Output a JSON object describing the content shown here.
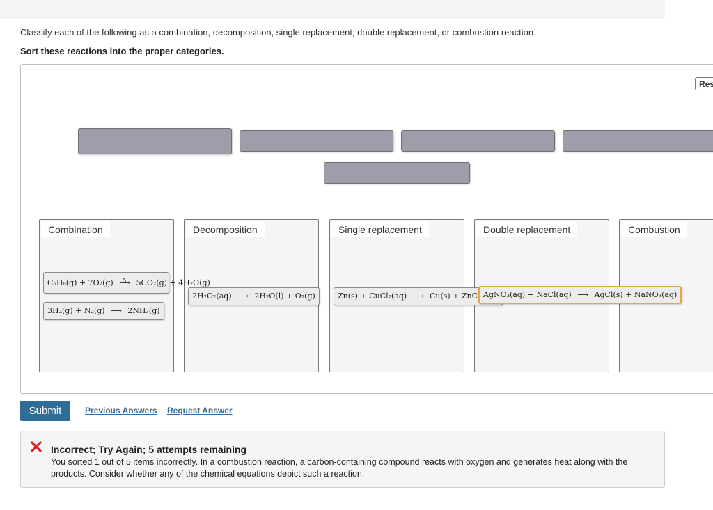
{
  "instructions": "Classify each of the following as a combination, decomposition, single replacement, double replacement, or combustion reaction.",
  "task": "Sort these reactions into the proper categories.",
  "reset_label": "Res",
  "bins": [
    {
      "label": "Combination"
    },
    {
      "label": "Decomposition"
    },
    {
      "label": "Single replacement"
    },
    {
      "label": "Double replacement"
    },
    {
      "label": "Combustion"
    }
  ],
  "items": [
    {
      "reactants": "C₅H₈(g) + 7O₂(g)",
      "delta": "Δ",
      "products": "5CO₂(g) + 4H₂O(g)",
      "bin": "Combination"
    },
    {
      "reactants": "3H₂(g) + N₂(g)",
      "products": "2NH₃(g)",
      "bin": "Combination"
    },
    {
      "reactants": "2H₂O₂(aq)",
      "products": "2H₂O(l) + O₂(g)",
      "bin": "Decomposition"
    },
    {
      "reactants": "Zn(s) + CuCl₂(aq)",
      "products": "Cu(s) + ZnCl₂(aq)",
      "bin": "Single replacement"
    },
    {
      "reactants": "AgNO₃(aq) + NaCl(aq)",
      "products": "AgCl(s) + NaNO₃(aq)",
      "bin": "Double replacement"
    }
  ],
  "arrow": "⟶",
  "submit_label": "Submit",
  "links": {
    "previous": "Previous Answers",
    "request": "Request Answer"
  },
  "feedback": {
    "title": "Incorrect; Try Again; 5 attempts remaining",
    "body": "You sorted 1 out of 5 items incorrectly. In a combustion reaction, a carbon-containing compound reacts with oxygen and generates heat along with the products. Consider whether any of the chemical equations depict such a reaction.",
    "icon_color": "#d62020"
  }
}
